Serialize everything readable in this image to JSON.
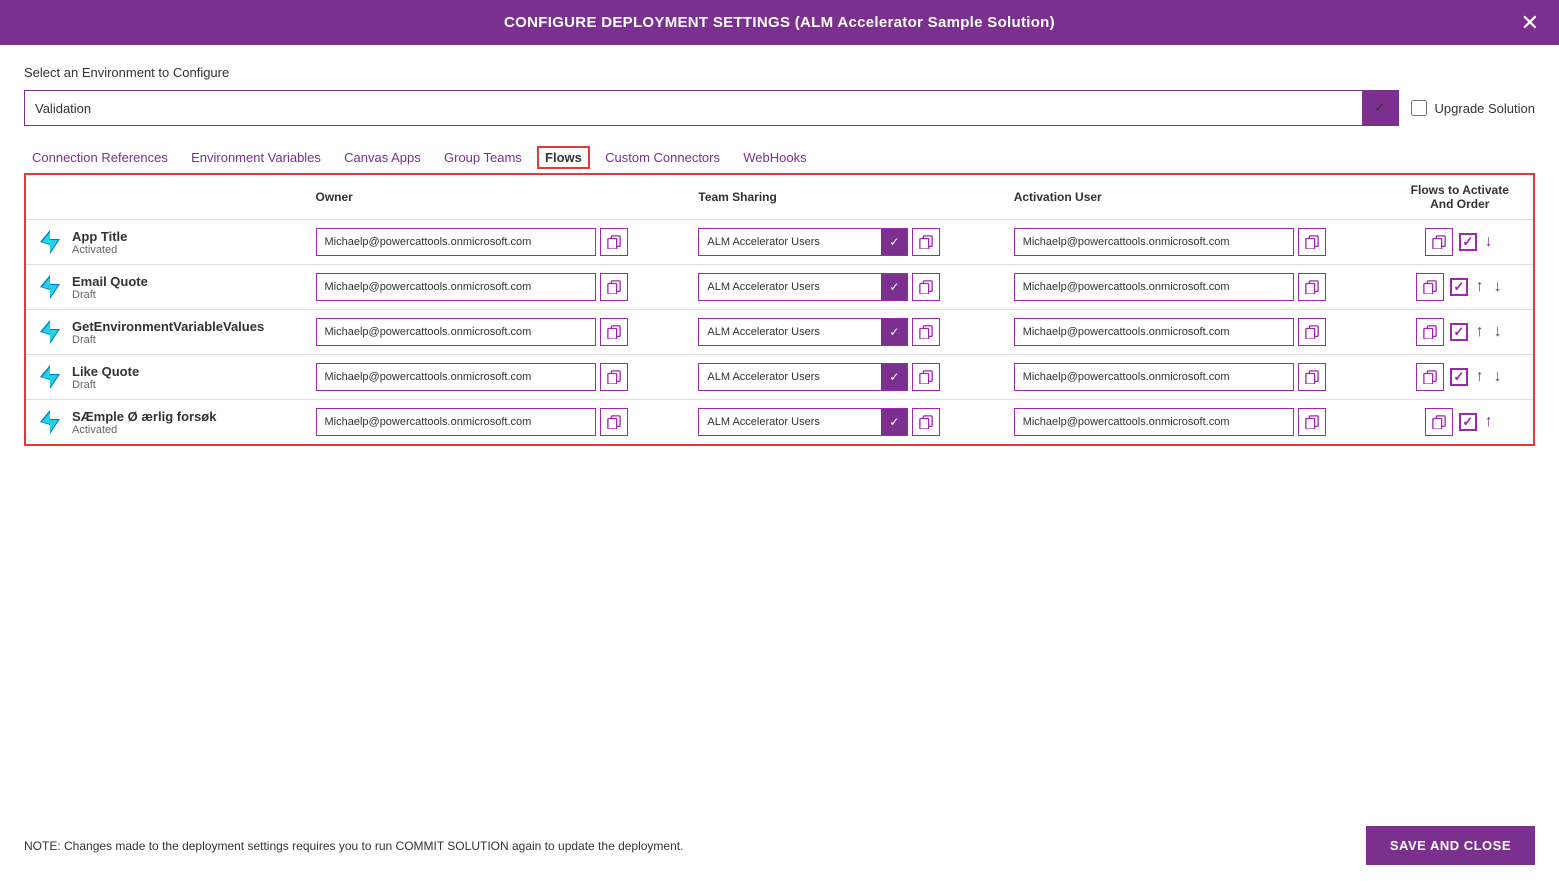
{
  "header": {
    "title": "CONFIGURE DEPLOYMENT SETTINGS (ALM Accelerator Sample Solution)",
    "close_label": "✕"
  },
  "env_section": {
    "label": "Select an Environment to Configure",
    "selected_env": "Validation",
    "chevron": "∨",
    "upgrade_label": "Upgrade Solution"
  },
  "tabs": [
    {
      "id": "connection-references",
      "label": "Connection References",
      "active": false
    },
    {
      "id": "environment-variables",
      "label": "Environment Variables",
      "active": false
    },
    {
      "id": "canvas-apps",
      "label": "Canvas Apps",
      "active": false
    },
    {
      "id": "group-teams",
      "label": "Group Teams",
      "active": false
    },
    {
      "id": "flows",
      "label": "Flows",
      "active": true
    },
    {
      "id": "custom-connectors",
      "label": "Custom Connectors",
      "active": false
    },
    {
      "id": "webhooks",
      "label": "WebHooks",
      "active": false
    }
  ],
  "table": {
    "headers": {
      "owner": "Owner",
      "team_sharing": "Team Sharing",
      "activation_user": "Activation User",
      "flows_activate": "Flows to Activate\nAnd Order"
    },
    "rows": [
      {
        "name": "App Title",
        "status": "Activated",
        "owner": "Michaelp@powercattools.onmicrosoft.com",
        "team": "ALM Accelerator Users",
        "activation_user": "Michaelp@powercattools.onmicrosoft.com",
        "checked": true,
        "has_up": false,
        "has_down": true
      },
      {
        "name": "Email Quote",
        "status": "Draft",
        "owner": "Michaelp@powercattools.onmicrosoft.com",
        "team": "ALM Accelerator Users",
        "activation_user": "Michaelp@powercattools.onmicrosoft.com",
        "checked": true,
        "has_up": true,
        "has_down": true
      },
      {
        "name": "GetEnvironmentVariableValues",
        "status": "Draft",
        "owner": "Michaelp@powercattools.onmicrosoft.com",
        "team": "ALM Accelerator Users",
        "activation_user": "Michaelp@powercattools.onmicrosoft.com",
        "checked": true,
        "has_up": true,
        "has_down": true
      },
      {
        "name": "Like Quote",
        "status": "Draft",
        "owner": "Michaelp@powercattools.onmicrosoft.com",
        "team": "ALM Accelerator Users",
        "activation_user": "Michaelp@powercattools.onmicrosoft.com",
        "checked": true,
        "has_up": true,
        "has_down": true
      },
      {
        "name": "SÆmple Ø ærlig forsøk",
        "status": "Activated",
        "owner": "Michaelp@powercattools.onmicrosoft.com",
        "team": "ALM Accelerator Users",
        "activation_user": "Michaelp@powercattools.onmicrosoft.com",
        "checked": true,
        "has_up": true,
        "has_down": false
      }
    ]
  },
  "footer": {
    "note": "NOTE: Changes made to the deployment settings requires you to run COMMIT SOLUTION again to update the deployment.",
    "save_close": "SAVE AND CLOSE"
  }
}
